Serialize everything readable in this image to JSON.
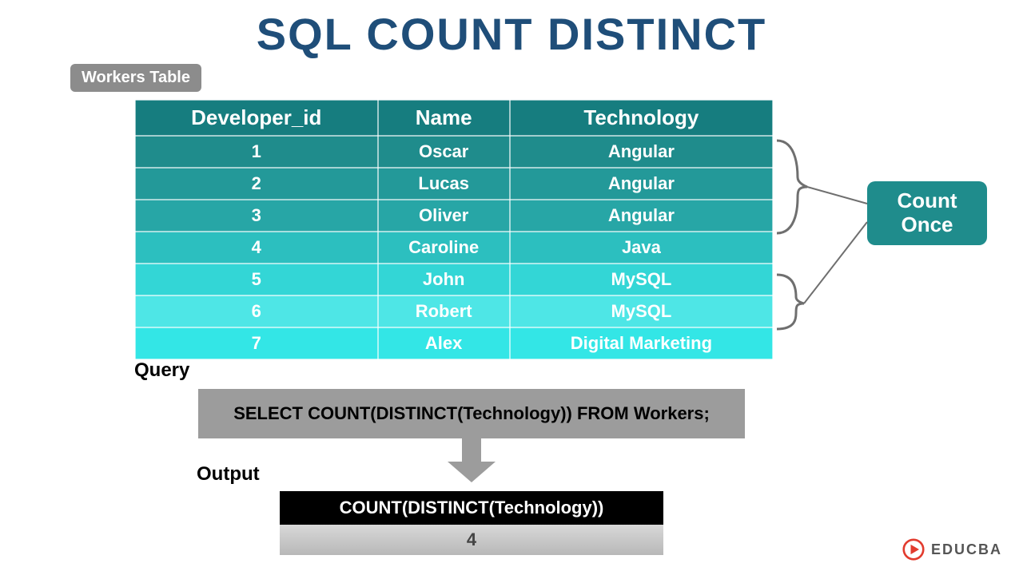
{
  "title": "SQL COUNT DISTINCT",
  "table_label": "Workers Table",
  "columns": [
    "Developer_id",
    "Name",
    "Technology"
  ],
  "rows": [
    {
      "id": "1",
      "name": "Oscar",
      "tech": "Angular"
    },
    {
      "id": "2",
      "name": "Lucas",
      "tech": "Angular"
    },
    {
      "id": "3",
      "name": "Oliver",
      "tech": "Angular"
    },
    {
      "id": "4",
      "name": "Caroline",
      "tech": "Java"
    },
    {
      "id": "5",
      "name": "John",
      "tech": "MySQL"
    },
    {
      "id": "6",
      "name": "Robert",
      "tech": "MySQL"
    },
    {
      "id": "7",
      "name": "Alex",
      "tech": "Digital Marketing"
    }
  ],
  "callout": "Count Once",
  "query_label": "Query",
  "query_text": "SELECT COUNT(DISTINCT(Technology)) FROM Workers;",
  "output_label": "Output",
  "output_header": "COUNT(DISTINCT(Technology))",
  "output_value": "4",
  "logo_text": "EDUCBA",
  "colors": {
    "title": "#1f4e79",
    "teal_dark": "#167d7f",
    "gray_box": "#9c9c9c"
  }
}
